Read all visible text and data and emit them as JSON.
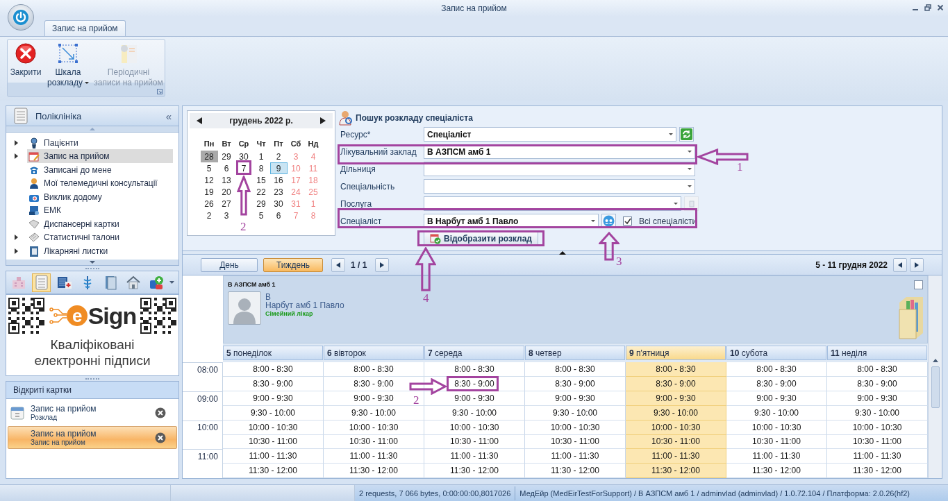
{
  "window": {
    "title": "Запис на прийом"
  },
  "ribbon": {
    "tabs": [
      {
        "label": "Запис на прийом",
        "selected": true
      }
    ],
    "buttons": [
      {
        "label": "Закрити",
        "dropdown": false,
        "disabled": false
      },
      {
        "label": "Шкала розкладу",
        "dropdown": true,
        "disabled": false
      },
      {
        "label": "Періодичні записи на прийом",
        "dropdown": false,
        "disabled": true
      }
    ]
  },
  "sidebar": {
    "title": "Поліклініка",
    "collapse": "«",
    "items": [
      {
        "label": "Пацієнти",
        "expandable": true,
        "selected": false
      },
      {
        "label": "Запис на прийом",
        "expandable": true,
        "selected": true
      },
      {
        "label": "Записані до мене",
        "expandable": false,
        "selected": false
      },
      {
        "label": "Мої телемедичні консультації",
        "expandable": false,
        "selected": false
      },
      {
        "label": "Виклик додому",
        "expandable": false,
        "selected": false
      },
      {
        "label": "ЕМК",
        "expandable": false,
        "selected": false
      },
      {
        "label": "Диспансерні картки",
        "expandable": false,
        "selected": false
      },
      {
        "label": "Статистичні талони",
        "expandable": true,
        "selected": false
      },
      {
        "label": "Лікарняні листки",
        "expandable": true,
        "selected": false
      }
    ],
    "toolbar": [
      {
        "selected": false
      },
      {
        "selected": true
      },
      {
        "selected": false
      },
      {
        "selected": false
      },
      {
        "selected": false
      },
      {
        "selected": false
      },
      {
        "selected": false
      }
    ]
  },
  "banner": {
    "logo_mark": "e",
    "logo_text": "Sign",
    "caption": "Кваліфіковані електронні підписи"
  },
  "open_cards": {
    "title": "Відкриті картки",
    "items": [
      {
        "title": "Запис на прийом",
        "subtitle": "Розклад",
        "selected": false
      },
      {
        "title": "Запис на прийом",
        "subtitle": "Запис на прийом",
        "selected": true
      }
    ]
  },
  "calendar": {
    "month": "грудень 2022 р.",
    "weekdays": [
      "Пн",
      "Вт",
      "Ср",
      "Чт",
      "Пт",
      "Сб",
      "Нд"
    ],
    "weeks": [
      [
        {
          "d": "28",
          "selected": true,
          "today": false
        },
        {
          "d": "29",
          "selected": false,
          "today": false
        },
        {
          "d": "30",
          "selected": false,
          "today": false
        },
        {
          "d": "1",
          "selected": false,
          "today": false
        },
        {
          "d": "2",
          "selected": false,
          "today": false
        },
        {
          "d": "3",
          "selected": false,
          "today": false
        },
        {
          "d": "4",
          "selected": false,
          "today": false
        }
      ],
      [
        {
          "d": "5",
          "selected": false,
          "today": false
        },
        {
          "d": "6",
          "selected": false,
          "today": false
        },
        {
          "d": "7",
          "selected": false,
          "today": false
        },
        {
          "d": "8",
          "selected": false,
          "today": false
        },
        {
          "d": "9",
          "selected": false,
          "today": true
        },
        {
          "d": "10",
          "selected": false,
          "today": false
        },
        {
          "d": "11",
          "selected": false,
          "today": false
        }
      ],
      [
        {
          "d": "12",
          "selected": false,
          "today": false
        },
        {
          "d": "13",
          "selected": false,
          "today": false
        },
        {
          "selected": false,
          "today": false
        },
        {
          "d": "15",
          "selected": false,
          "today": false
        },
        {
          "d": "16",
          "selected": false,
          "today": false
        },
        {
          "d": "17",
          "selected": false,
          "today": false
        },
        {
          "d": "18",
          "selected": false,
          "today": false
        }
      ],
      [
        {
          "d": "19",
          "selected": false,
          "today": false
        },
        {
          "d": "20",
          "selected": false,
          "today": false
        },
        {
          "selected": false,
          "today": false
        },
        {
          "d": "22",
          "selected": false,
          "today": false
        },
        {
          "d": "23",
          "selected": false,
          "today": false
        },
        {
          "d": "24",
          "selected": false,
          "today": false
        },
        {
          "d": "25",
          "selected": false,
          "today": false
        }
      ],
      [
        {
          "d": "26",
          "selected": false,
          "today": false
        },
        {
          "d": "27",
          "selected": false,
          "today": false
        },
        {
          "selected": false,
          "today": false
        },
        {
          "d": "29",
          "selected": false,
          "today": false
        },
        {
          "d": "30",
          "selected": false,
          "today": false
        },
        {
          "d": "31",
          "selected": false,
          "today": false
        },
        {
          "d": "1",
          "selected": false,
          "today": false
        }
      ],
      [
        {
          "d": "2",
          "selected": false,
          "today": false
        },
        {
          "d": "3",
          "selected": false,
          "today": false
        },
        {
          "selected": false,
          "today": false
        },
        {
          "d": "5",
          "selected": false,
          "today": false
        },
        {
          "d": "6",
          "selected": false,
          "today": false
        },
        {
          "d": "7",
          "selected": false,
          "today": false
        },
        {
          "d": "8",
          "selected": false,
          "today": false
        }
      ]
    ]
  },
  "search": {
    "title": "Пошук розкладу спеціаліста",
    "fields": [
      {
        "label": "Ресурс*",
        "value": "Спеціаліст",
        "kind": "refresh"
      },
      {
        "label": "Лікувальний заклад",
        "value": "В АЗПСМ амб 1",
        "kind": "plain"
      },
      {
        "label": "Дільниця",
        "kind": "plain"
      },
      {
        "label": "Спеціальність",
        "kind": "plain"
      },
      {
        "label": "Послуга",
        "kind": "disabled-button"
      },
      {
        "label": "Спеціаліст",
        "value": "В Нарбут амб 1 Павло",
        "kind": "specialist"
      }
    ],
    "all_specialists": {
      "label": "Всі спеціалісти",
      "checked": true
    },
    "show_button": "Відобразити розклад"
  },
  "schedule": {
    "views": [
      {
        "label": "День",
        "selected": false
      },
      {
        "label": "Тиждень",
        "selected": true
      }
    ],
    "page": "1 / 1",
    "range": "5 - 11 грудня 2022",
    "resource": {
      "facility": "В АЗПСМ амб 1",
      "line1": "В",
      "name": "Нарбут амб 1 Павло",
      "role": "Сімейний лікар",
      "checked": false
    },
    "days": [
      {
        "num": "5",
        "name": "понеділок",
        "today": false
      },
      {
        "num": "6",
        "name": "вівторок",
        "today": false
      },
      {
        "num": "7",
        "name": "середа",
        "today": false
      },
      {
        "num": "8",
        "name": "четвер",
        "today": false
      },
      {
        "num": "9",
        "name": "п'ятниця",
        "today": true
      },
      {
        "num": "10",
        "name": "субота",
        "today": false
      },
      {
        "num": "11",
        "name": "неділя",
        "today": false
      }
    ],
    "rows": [
      {
        "hour": "08:00",
        "slots": [
          "8:00 - 8:30",
          "8:00 - 8:30",
          "8:00 - 8:30",
          "8:00 - 8:30",
          "8:00 - 8:30",
          "8:00 - 8:30",
          "8:00 - 8:30"
        ]
      },
      {
        "slots": [
          "8:30 - 9:00",
          "8:30 - 9:00",
          "8:30 - 9:00",
          "8:30 - 9:00",
          "8:30 - 9:00",
          "8:30 - 9:00",
          "8:30 - 9:00"
        ]
      },
      {
        "hour": "09:00",
        "slots": [
          "9:00 - 9:30",
          "9:00 - 9:30",
          "9:00 - 9:30",
          "9:00 - 9:30",
          "9:00 - 9:30",
          "9:00 - 9:30",
          "9:00 - 9:30"
        ]
      },
      {
        "slots": [
          "9:30 - 10:00",
          "9:30 - 10:00",
          "9:30 - 10:00",
          "9:30 - 10:00",
          "9:30 - 10:00",
          "9:30 - 10:00",
          "9:30 - 10:00"
        ]
      },
      {
        "hour": "10:00",
        "slots": [
          "10:00 - 10:30",
          "10:00 - 10:30",
          "10:00 - 10:30",
          "10:00 - 10:30",
          "10:00 - 10:30",
          "10:00 - 10:30",
          "10:00 - 10:30"
        ]
      },
      {
        "slots": [
          "10:30 - 11:00",
          "10:30 - 11:00",
          "10:30 - 11:00",
          "10:30 - 11:00",
          "10:30 - 11:00",
          "10:30 - 11:00",
          "10:30 - 11:00"
        ]
      },
      {
        "hour": "11:00",
        "slots": [
          "11:00 - 11:30",
          "11:00 - 11:30",
          "11:00 - 11:30",
          "11:00 - 11:30",
          "11:00 - 11:30",
          "11:00 - 11:30",
          "11:00 - 11:30"
        ]
      },
      {
        "slots": [
          "11:30 - 12:00",
          "11:30 - 12:00",
          "11:30 - 12:00",
          "11:30 - 12:00",
          "11:30 - 12:00",
          "11:30 - 12:00",
          "11:30 - 12:00"
        ]
      }
    ]
  },
  "status_bar": {
    "requests": "2 requests, 7 066 bytes, 0:00:00:00,8017026",
    "session": "МедЕйр (MedEirTestForSupport) / В АЗПСМ амб 1 / adminvlad (adminvlad) / 1.0.72.104 / Платформа: 2.0.26(hf2)"
  },
  "annotations": [
    {
      "kind": "box"
    },
    {
      "kind": "box"
    },
    {
      "kind": "box"
    },
    {
      "kind": "box"
    },
    {
      "kind": "box"
    },
    {
      "kind": "arrow",
      "label": "1"
    },
    {
      "kind": "arrow",
      "label": "2"
    },
    {
      "kind": "arrow",
      "label": "3"
    },
    {
      "kind": "arrow",
      "label": "4"
    },
    {
      "kind": "arrow",
      "label": "2"
    }
  ]
}
